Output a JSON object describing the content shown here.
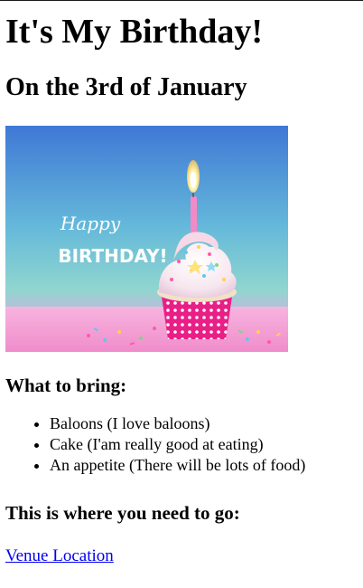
{
  "page": {
    "title": "It's My Birthday!",
    "subtitle": "On the 3rd of January"
  },
  "hero": {
    "image_text_top": "Happy",
    "image_text_bottom": "BIRTHDAY!"
  },
  "bring": {
    "heading": "What to bring:",
    "items": [
      "Baloons (I love baloons)",
      "Cake (I'am really good at eating)",
      "An appetite (There will be lots of food)"
    ]
  },
  "directions": {
    "heading": "This is where you need to go:",
    "link_label": "Venue Location"
  },
  "colors": {
    "link": "#0000ee",
    "hero_sky": "#4a86d8",
    "hero_teal": "#64c9cf",
    "hero_pink": "#f3a9d8"
  }
}
